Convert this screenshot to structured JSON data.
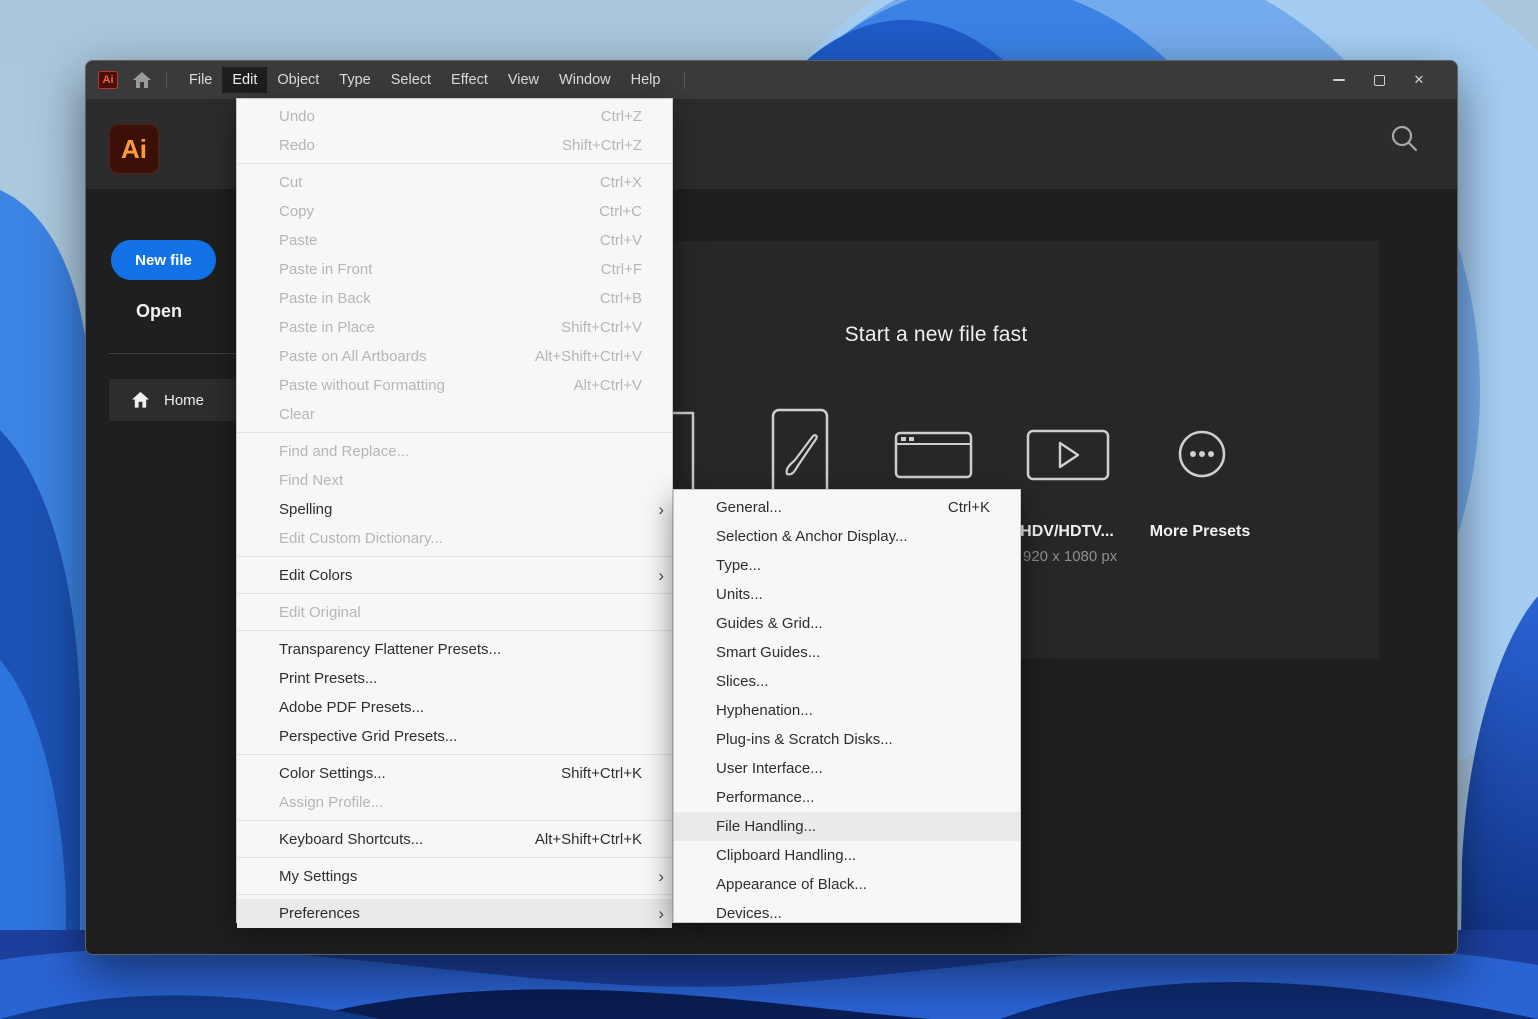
{
  "colors": {
    "accent_blue": "#1373E6",
    "logo_orange": "#FF9A3C",
    "titlebar_gray": "#3A3A3A",
    "menu_bg": "#F7F7F7",
    "content_bg": "#1F1F1F"
  },
  "icons": {
    "chevron_right": "›",
    "minimize": "–",
    "close": "✕"
  },
  "titlebar": {
    "app_badge": "Ai",
    "menubar_items": [
      {
        "label": "File"
      },
      {
        "label": "Edit",
        "active": true
      },
      {
        "label": "Object"
      },
      {
        "label": "Type"
      },
      {
        "label": "Select"
      },
      {
        "label": "Effect"
      },
      {
        "label": "View"
      },
      {
        "label": "Window"
      },
      {
        "label": "Help"
      }
    ]
  },
  "header": {
    "logo_text": "Ai"
  },
  "sidebar": {
    "new_file": "New file",
    "open": "Open",
    "home": "Home"
  },
  "main": {
    "title": "Start a new file fast",
    "hdv_label": "HDV/HDTV...",
    "hdv_size": "920 x 1080 px",
    "more_presets": "More Presets"
  },
  "edit_menu": {
    "items": [
      {
        "label": "Undo",
        "shortcut": "Ctrl+Z",
        "disabled": true
      },
      {
        "label": "Redo",
        "shortcut": "Shift+Ctrl+Z",
        "disabled": true,
        "separator_after": true
      },
      {
        "label": "Cut",
        "shortcut": "Ctrl+X",
        "disabled": true
      },
      {
        "label": "Copy",
        "shortcut": "Ctrl+C",
        "disabled": true
      },
      {
        "label": "Paste",
        "shortcut": "Ctrl+V",
        "disabled": true
      },
      {
        "label": "Paste in Front",
        "shortcut": "Ctrl+F",
        "disabled": true
      },
      {
        "label": "Paste in Back",
        "shortcut": "Ctrl+B",
        "disabled": true
      },
      {
        "label": "Paste in Place",
        "shortcut": "Shift+Ctrl+V",
        "disabled": true
      },
      {
        "label": "Paste on All Artboards",
        "shortcut": "Alt+Shift+Ctrl+V",
        "disabled": true
      },
      {
        "label": "Paste without Formatting",
        "shortcut": "Alt+Ctrl+V",
        "disabled": true
      },
      {
        "label": "Clear",
        "disabled": true,
        "separator_after": true
      },
      {
        "label": "Find and Replace...",
        "disabled": true
      },
      {
        "label": "Find Next",
        "disabled": true
      },
      {
        "label": "Spelling",
        "submenu": true
      },
      {
        "label": "Edit Custom Dictionary...",
        "disabled": true,
        "separator_after": true
      },
      {
        "label": "Edit Colors",
        "submenu": true,
        "separator_after": true
      },
      {
        "label": "Edit Original",
        "disabled": true,
        "separator_after": true
      },
      {
        "label": "Transparency Flattener Presets..."
      },
      {
        "label": "Print Presets..."
      },
      {
        "label": "Adobe PDF Presets..."
      },
      {
        "label": "Perspective Grid Presets...",
        "separator_after": true
      },
      {
        "label": "Color Settings...",
        "shortcut": "Shift+Ctrl+K"
      },
      {
        "label": "Assign Profile...",
        "disabled": true,
        "separator_after": true
      },
      {
        "label": "Keyboard Shortcuts...",
        "shortcut": "Alt+Shift+Ctrl+K",
        "separator_after": true
      },
      {
        "label": "My Settings",
        "submenu": true,
        "separator_after": true
      },
      {
        "label": "Preferences",
        "submenu": true,
        "highlighted": true
      }
    ]
  },
  "preferences_submenu": {
    "items": [
      {
        "label": "General...",
        "shortcut": "Ctrl+K"
      },
      {
        "label": "Selection & Anchor Display..."
      },
      {
        "label": "Type..."
      },
      {
        "label": "Units..."
      },
      {
        "label": "Guides & Grid..."
      },
      {
        "label": "Smart Guides..."
      },
      {
        "label": "Slices..."
      },
      {
        "label": "Hyphenation..."
      },
      {
        "label": "Plug-ins & Scratch Disks..."
      },
      {
        "label": "User Interface..."
      },
      {
        "label": "Performance..."
      },
      {
        "label": "File Handling...",
        "highlighted": true
      },
      {
        "label": "Clipboard Handling..."
      },
      {
        "label": "Appearance of Black..."
      },
      {
        "label": "Devices..."
      }
    ]
  }
}
